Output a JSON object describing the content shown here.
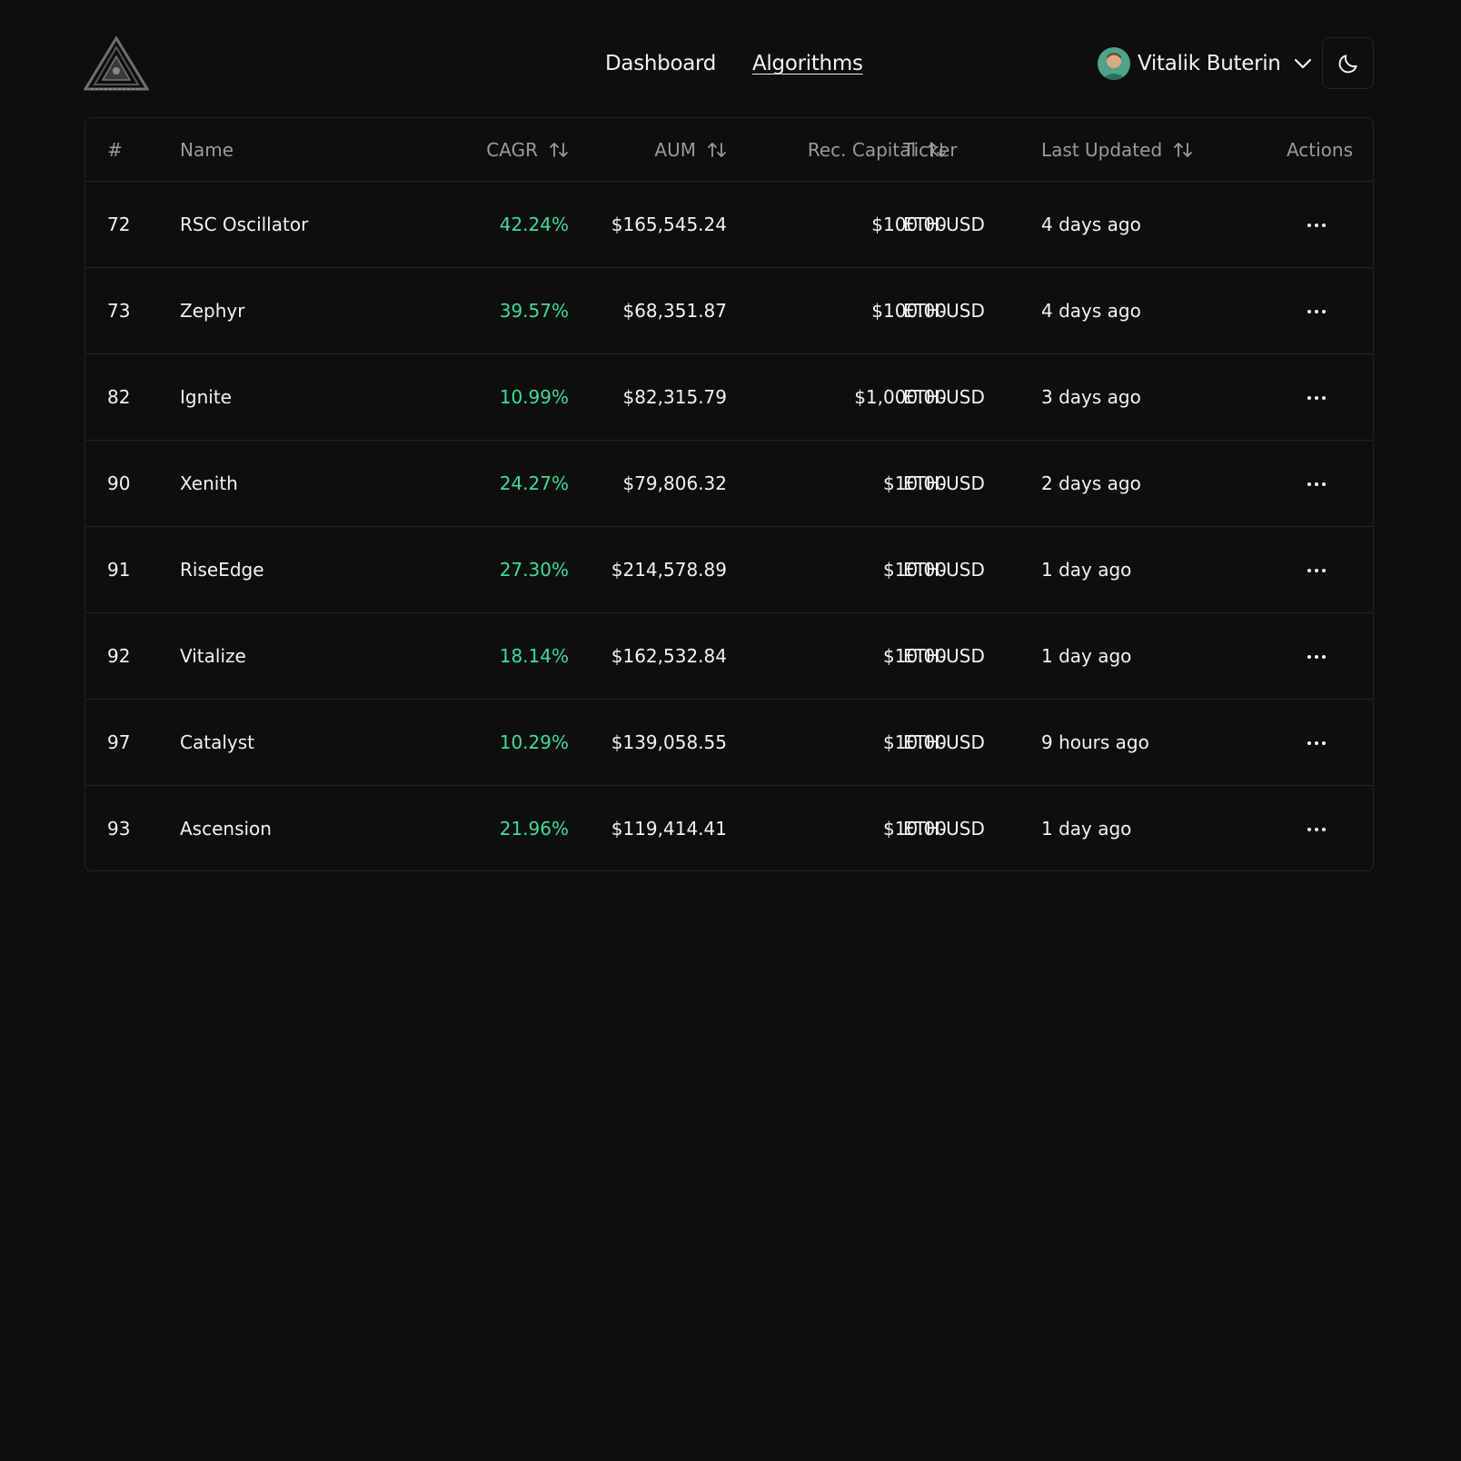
{
  "header": {
    "nav": [
      {
        "label": "Dashboard",
        "active": false
      },
      {
        "label": "Algorithms",
        "active": true
      }
    ],
    "user": {
      "name": "Vitalik Buterin"
    },
    "theme_toggle_icon": "moon-icon"
  },
  "table": {
    "columns": {
      "num": "#",
      "name": "Name",
      "cagr": "CAGR",
      "aum": "AUM",
      "capital": "Rec. Capital",
      "ticker": "Ticker",
      "updated": "Last Updated",
      "actions": "Actions"
    },
    "rows": [
      {
        "num": "72",
        "name": "RSC Oscillator",
        "cagr": "42.24%",
        "aum": "$165,545.24",
        "capital": "$100.00",
        "ticker": "ETH-USD",
        "updated": "4 days ago"
      },
      {
        "num": "73",
        "name": "Zephyr",
        "cagr": "39.57%",
        "aum": "$68,351.87",
        "capital": "$100.00",
        "ticker": "ETH-USD",
        "updated": "4 days ago"
      },
      {
        "num": "82",
        "name": "Ignite",
        "cagr": "10.99%",
        "aum": "$82,315.79",
        "capital": "$1,000.00",
        "ticker": "ETH-USD",
        "updated": "3 days ago"
      },
      {
        "num": "90",
        "name": "Xenith",
        "cagr": "24.27%",
        "aum": "$79,806.32",
        "capital": "$10.00",
        "ticker": "ETH-USD",
        "updated": "2 days ago"
      },
      {
        "num": "91",
        "name": "RiseEdge",
        "cagr": "27.30%",
        "aum": "$214,578.89",
        "capital": "$10.00",
        "ticker": "ETH-USD",
        "updated": "1 day ago"
      },
      {
        "num": "92",
        "name": "Vitalize",
        "cagr": "18.14%",
        "aum": "$162,532.84",
        "capital": "$10.00",
        "ticker": "ETH-USD",
        "updated": "1 day ago"
      },
      {
        "num": "97",
        "name": "Catalyst",
        "cagr": "10.29%",
        "aum": "$139,058.55",
        "capital": "$10.00",
        "ticker": "ETH-USD",
        "updated": "9 hours ago"
      },
      {
        "num": "93",
        "name": "Ascension",
        "cagr": "21.96%",
        "aum": "$119,414.41",
        "capital": "$10.00",
        "ticker": "ETH-USD",
        "updated": "1 day ago"
      }
    ]
  },
  "colors": {
    "background": "#0e0e0e",
    "border": "#242424",
    "positive": "#3ddc97",
    "header_text": "#9a9a9a"
  }
}
